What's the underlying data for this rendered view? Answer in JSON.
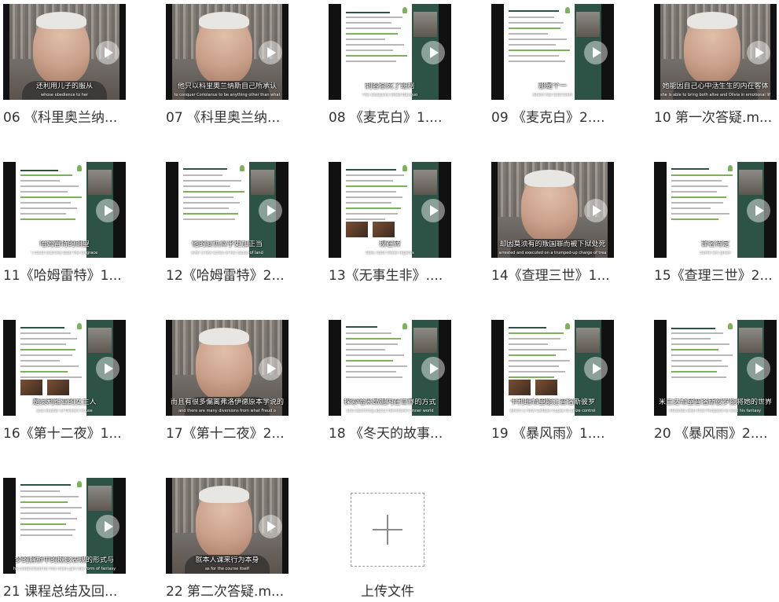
{
  "files": [
    {
      "name": "06 《科里奥兰纳...",
      "kind": "webcam",
      "subtitle_zh": "还利用儿子的服从",
      "subtitle_en": "whose obedience to her"
    },
    {
      "name": "07 《科里奥兰纳...",
      "kind": "webcam",
      "subtitle_zh": "他只以科里奥兰纳斯自己所承认",
      "subtitle_en": "to conquer Coriolanus to be anything other than what"
    },
    {
      "name": "08 《麦克白》1....",
      "kind": "slide",
      "subtitle_zh": "刺客杀死了班柯",
      "subtitle_en": "The assassins killed Banquo"
    },
    {
      "name": "09 《麦克白》2....",
      "kind": "slide",
      "subtitle_zh": "那是个一",
      "subtitle_en": "which has told them"
    },
    {
      "name": "10 第一次答疑.m...",
      "kind": "webcam",
      "subtitle_zh": "她能因自己心中活生生的内在客体",
      "subtitle_en": "she is able to bring both alive and Olivia in emotional lif"
    },
    {
      "name": "11《哈姆雷特》1...",
      "kind": "slide",
      "subtitle_zh": "哈姆雷特的期望",
      "subtitle_en": "I could scarcely bear the disgrace"
    },
    {
      "name": "12《哈姆雷特》2...",
      "kind": "slide",
      "subtitle_zh": "他的复仇似乎更加正当",
      "subtitle_en": "ever a few acres of his cause of land"
    },
    {
      "name": "13《无事生非》....",
      "kind": "slide",
      "subtitle_zh": "现在转",
      "subtitle_en": "Now, both these regents"
    },
    {
      "name": "14《查理三世》1...",
      "kind": "webcam",
      "subtitle_zh": "却因莫须有的叛国罪而被下狱处死",
      "subtitle_en": "arrested and executed on a trumped-up charge of trea"
    },
    {
      "name": "15《查理三世》2...",
      "kind": "slide",
      "subtitle_zh": "译名待定",
      "subtitle_en": "Some are given"
    },
    {
      "name": "16《第十二夜》1...",
      "kind": "slide",
      "subtitle_zh": "是奥利维亚的女主人",
      "subtitle_en": "and master of Olivia's house"
    },
    {
      "name": "17《第十二夜》2...",
      "kind": "webcam",
      "subtitle_zh": "而且有很多偏离弗洛伊德原本学说的",
      "subtitle_en": "and there are many diversions from what Freud o"
    },
    {
      "name": "18 《冬天的故事...",
      "kind": "slide",
      "subtitle_zh": "探索哈米昂妮内在世界的方式",
      "subtitle_en": "and searching about Hermione's inner world"
    },
    {
      "name": "19 《暴风雨》1....",
      "kind": "slide",
      "subtitle_zh": "卡利班希望能让普洛斯彼罗",
      "subtitle_en": "which is how Caliban hopes to seize control"
    },
    {
      "name": "20 《暴风雨》2....",
      "kind": "slide",
      "subtitle_zh": "米兰达希望普洛斯彼罗能将她的世界",
      "subtitle_en": "Miranda wish that Prospero to lead his fantasy"
    },
    {
      "name": "21 课程总结及回...",
      "kind": "slide",
      "subtitle_zh": "梦的解析中的概念表现的形式与",
      "subtitle_en": "he understood for the most part the form of fantasy"
    },
    {
      "name": "22 第二次答疑.m...",
      "kind": "webcam",
      "subtitle_zh": "就本人课来行为本身",
      "subtitle_en": "as for the course itself"
    }
  ],
  "upload": {
    "label": "上传文件"
  },
  "icons": {
    "play": "play-icon",
    "upload": "plus-icon"
  },
  "colors": {
    "slide_sidebar": "#2d5346",
    "accent_green": "#7bb25b",
    "text": "#333333"
  }
}
